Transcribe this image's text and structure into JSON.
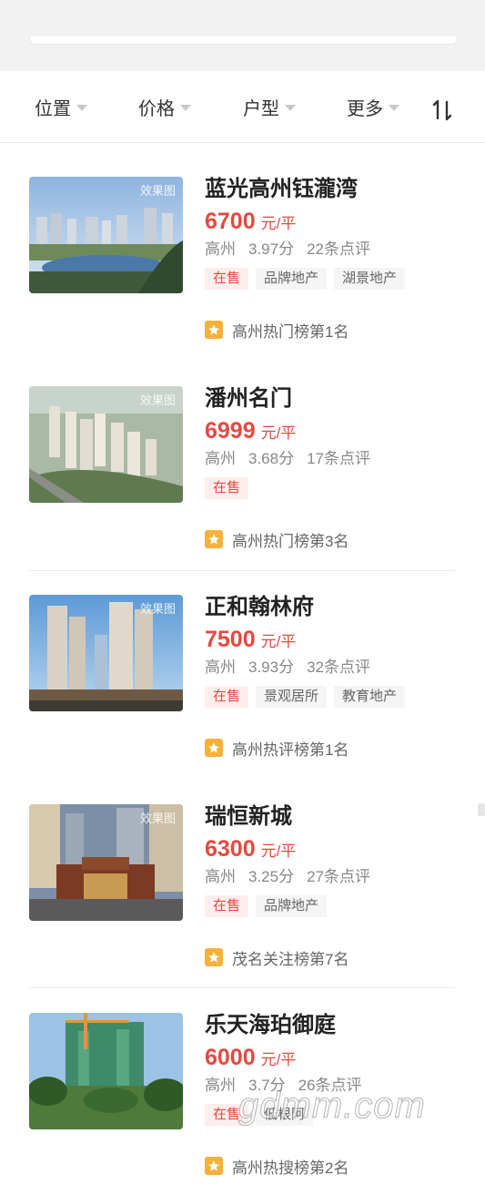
{
  "filters": [
    {
      "label": "位置"
    },
    {
      "label": "价格"
    },
    {
      "label": "户型"
    },
    {
      "label": "更多"
    }
  ],
  "listings": [
    {
      "name": "蓝光高州钰瀧湾",
      "image_tag": "效果图",
      "price": "6700",
      "unit": "元/平",
      "district": "高州",
      "score": "3.97分",
      "reviews": "22条点评",
      "tags": [
        "在售",
        "品牌地产",
        "湖景地产"
      ],
      "rank": "高州热门榜第1名"
    },
    {
      "name": "潘州名门",
      "image_tag": "效果图",
      "price": "6999",
      "unit": "元/平",
      "district": "高州",
      "score": "3.68分",
      "reviews": "17条点评",
      "tags": [
        "在售"
      ],
      "rank": "高州热门榜第3名"
    },
    {
      "name": "正和翰林府",
      "image_tag": "效果图",
      "price": "7500",
      "unit": "元/平",
      "district": "高州",
      "score": "3.93分",
      "reviews": "32条点评",
      "tags": [
        "在售",
        "景观居所",
        "教育地产"
      ],
      "rank": "高州热评榜第1名"
    },
    {
      "name": "瑞恒新城",
      "image_tag": "效果图",
      "price": "6300",
      "unit": "元/平",
      "district": "高州",
      "score": "3.25分",
      "reviews": "27条点评",
      "tags": [
        "在售",
        "品牌地产"
      ],
      "rank": "茂名关注榜第7名"
    },
    {
      "name": "乐天海珀御庭",
      "image_tag": "",
      "price": "6000",
      "unit": "元/平",
      "district": "高州",
      "score": "3.7分",
      "reviews": "26条点评",
      "tags": [
        "在售",
        "低根阿"
      ],
      "rank": "高州热搜榜第2名"
    }
  ],
  "watermark": "gdmm.com",
  "colors": {
    "price": "#e8483f",
    "star": "#f7b13a",
    "sale_tag_bg": "#fdeeed"
  }
}
